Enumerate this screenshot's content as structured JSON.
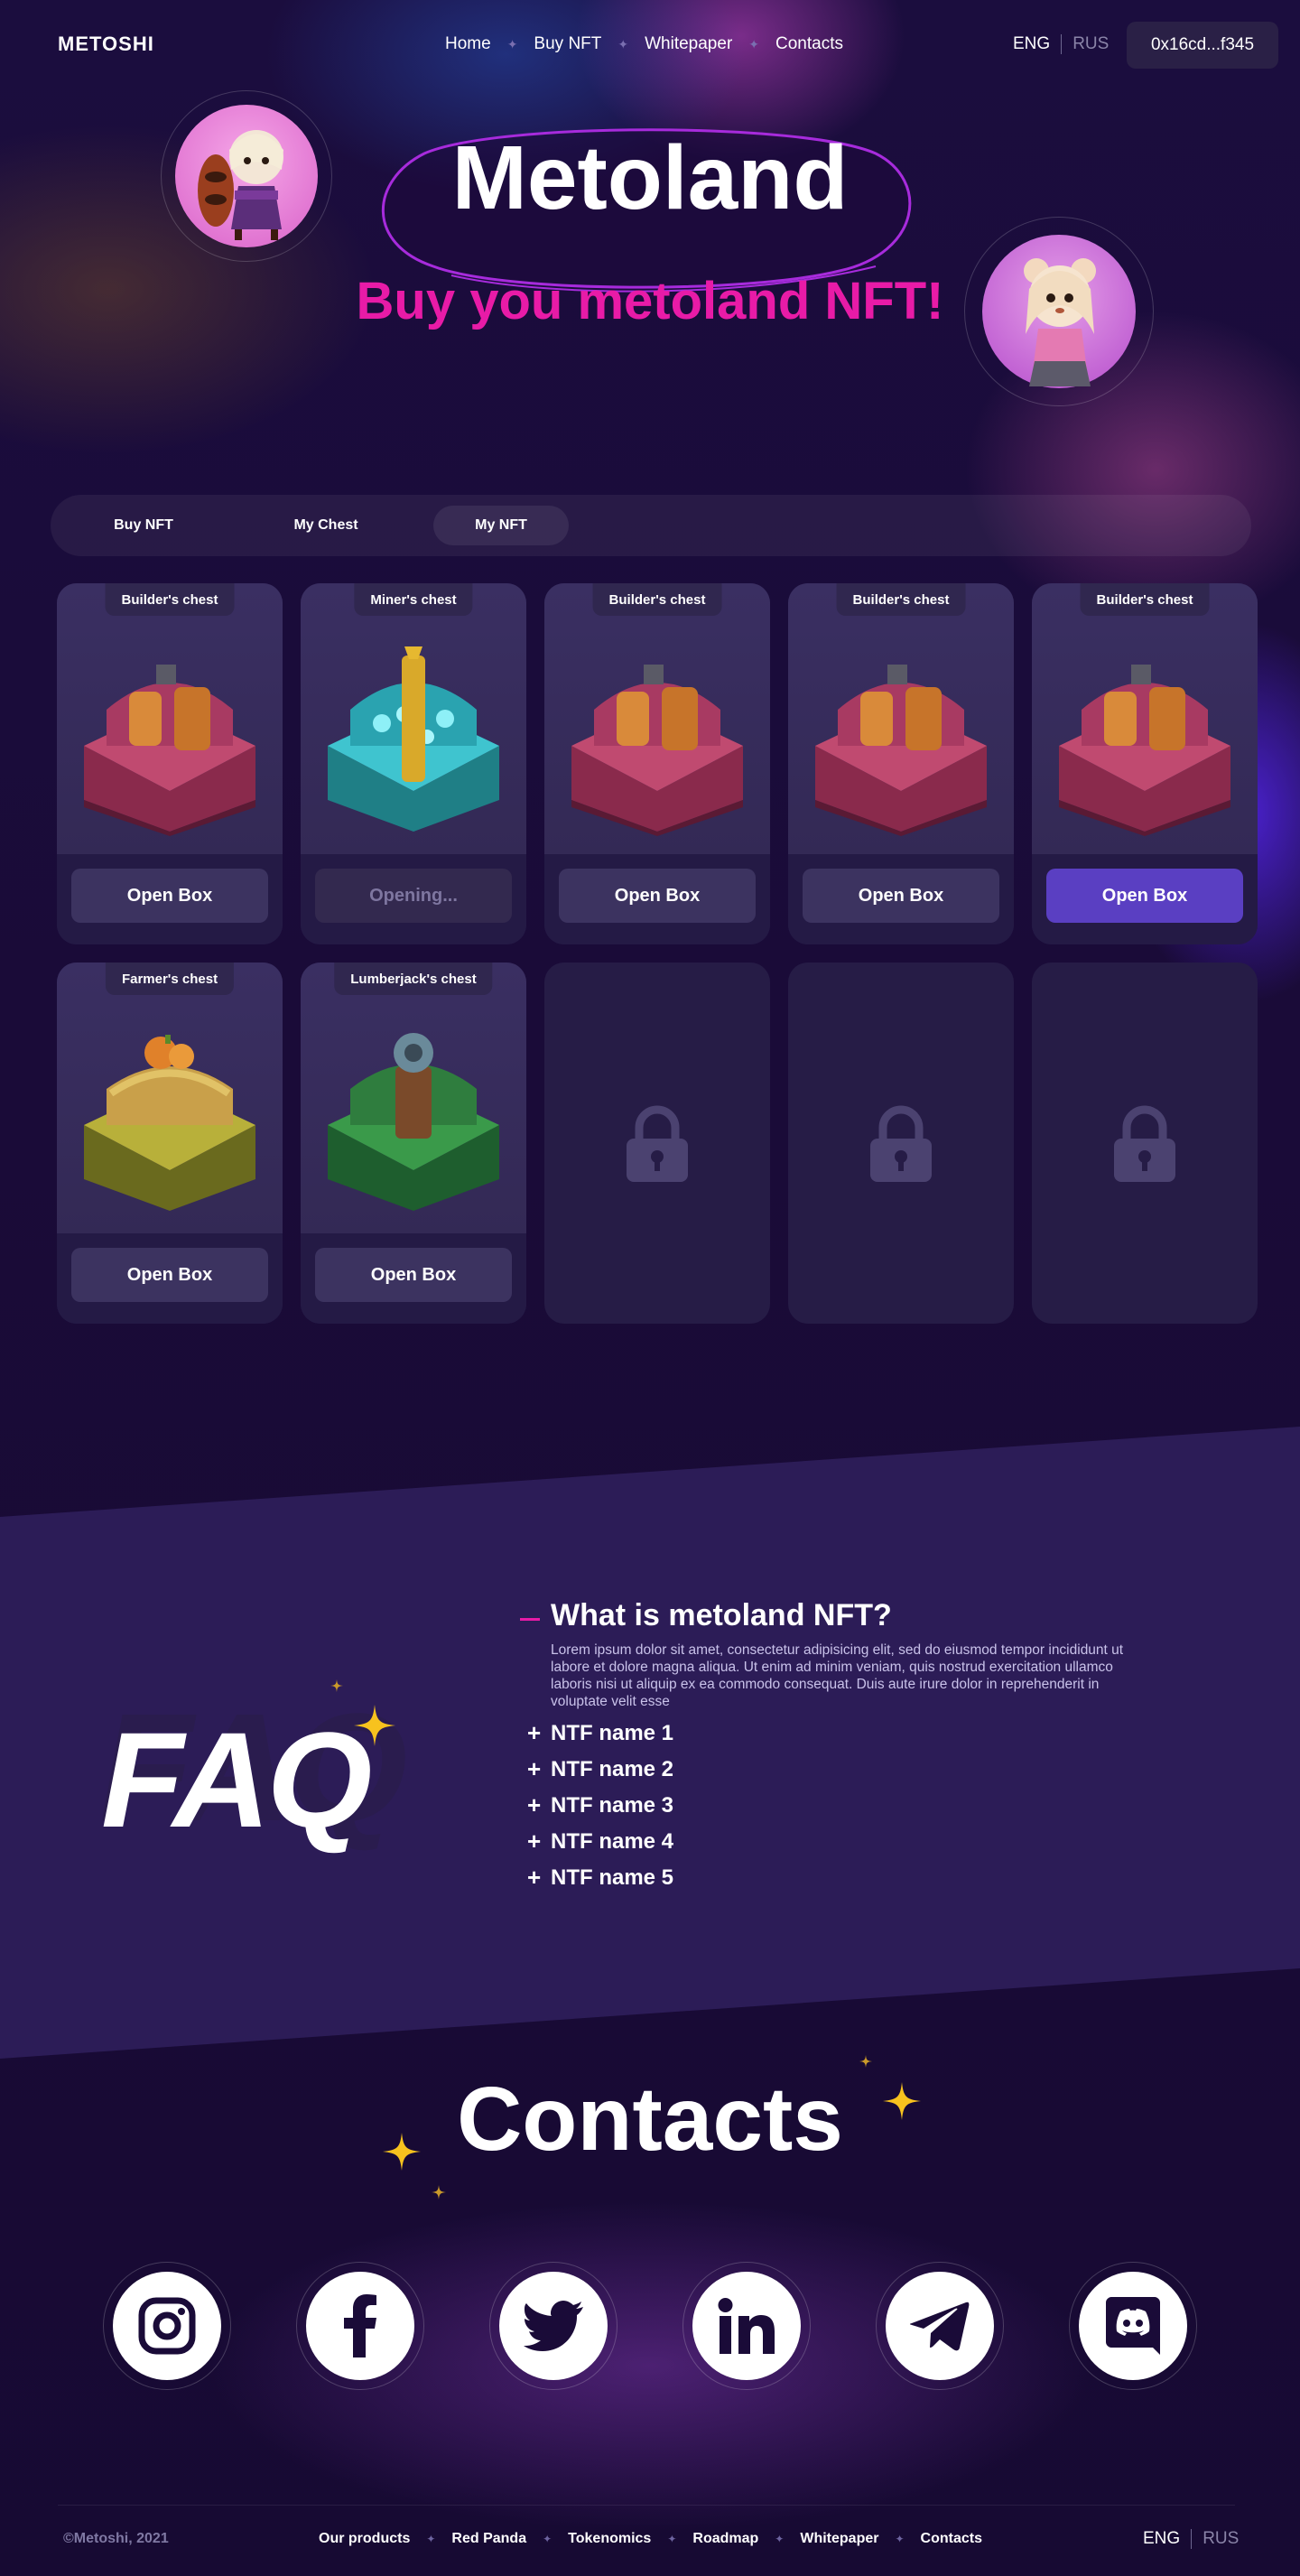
{
  "header": {
    "logo": "METOSHI",
    "nav": [
      "Home",
      "Buy NFT",
      "Whitepaper",
      "Contacts"
    ],
    "lang_active": "ENG",
    "lang_inactive": "RUS",
    "wallet": "0x16cd...f345"
  },
  "hero": {
    "title": "Metoland",
    "subtitle": "Buy you metoland NFT!"
  },
  "tabs": [
    "Buy NFT",
    "My Chest",
    "My NFT"
  ],
  "active_tab": "My NFT",
  "cards": [
    {
      "name": "Builder's chest",
      "button": "Open Box",
      "state": "normal",
      "chest": "builder"
    },
    {
      "name": "Miner's chest",
      "button": "Opening...",
      "state": "disabled",
      "chest": "miner"
    },
    {
      "name": "Builder's chest",
      "button": "Open Box",
      "state": "normal",
      "chest": "builder"
    },
    {
      "name": "Builder's chest",
      "button": "Open Box",
      "state": "normal",
      "chest": "builder"
    },
    {
      "name": "Builder's chest",
      "button": "Open Box",
      "state": "hover",
      "chest": "builder"
    },
    {
      "name": "Farmer's chest",
      "button": "Open Box",
      "state": "normal",
      "chest": "farmer"
    },
    {
      "name": "Lumberjack's chest",
      "button": "Open Box",
      "state": "normal",
      "chest": "lumberjack"
    }
  ],
  "locked_slots": 3,
  "faq": {
    "big_label": "FAQ",
    "question": "What is metoland NFT?",
    "answer": "Lorem ipsum dolor sit amet, consectetur adipisicing elit, sed do eiusmod tempor incididunt ut labore et dolore magna aliqua. Ut enim ad minim veniam, quis nostrud exercitation ullamco laboris nisi ut aliquip ex ea commodo consequat. Duis aute irure dolor in reprehenderit in voluptate velit esse",
    "items": [
      "NTF name 1",
      "NTF name 2",
      "NTF name 3",
      "NTF name 4",
      "NTF name 5"
    ]
  },
  "contacts": {
    "title": "Contacts",
    "socials": [
      "instagram-icon",
      "facebook-icon",
      "twitter-icon",
      "linkedin-icon",
      "telegram-icon",
      "discord-icon"
    ]
  },
  "footer": {
    "copyright": "©Metoshi, 2021",
    "links": [
      "Our products",
      "Red Panda",
      "Tokenomics",
      "Roadmap",
      "Whitepaper",
      "Contacts"
    ],
    "lang_active": "ENG",
    "lang_inactive": "RUS"
  },
  "colors": {
    "accent_pink": "#e81ba7",
    "star_yellow": "#f7c21e",
    "button_hover": "#5a3fc2"
  }
}
